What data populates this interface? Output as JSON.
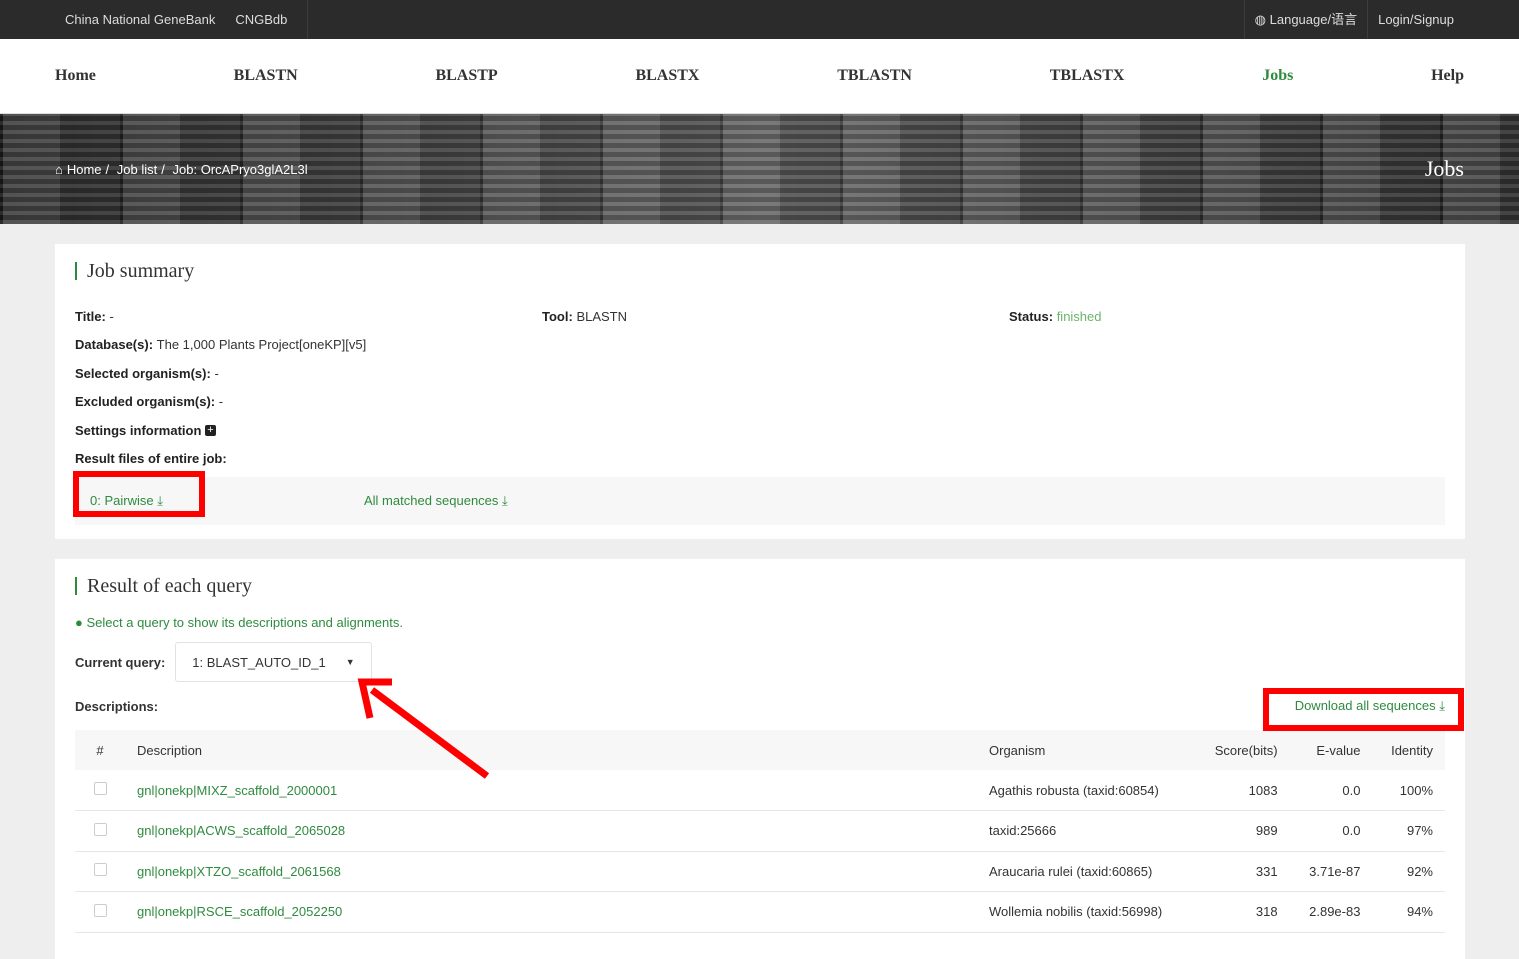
{
  "topbar": {
    "links": [
      "China National GeneBank",
      "CNGBdb"
    ],
    "language": "Language/语言",
    "login": "Login/Signup"
  },
  "nav": {
    "items": [
      "Home",
      "BLASTN",
      "BLASTP",
      "BLASTX",
      "TBLASTN",
      "TBLASTX",
      "Jobs",
      "Help"
    ],
    "active": "Jobs"
  },
  "banner": {
    "breadcrumb": [
      "Home",
      "Job list",
      "Job: OrcAPryo3glA2L3l"
    ],
    "title": "Jobs"
  },
  "summary": {
    "heading": "Job summary",
    "title_label": "Title:",
    "title_value": "-",
    "tool_label": "Tool:",
    "tool_value": "BLASTN",
    "status_label": "Status:",
    "status_value": "finished",
    "db_label": "Database(s):",
    "db_value": "The 1,000 Plants Project[oneKP][v5]",
    "sel_label": "Selected organism(s):",
    "sel_value": "-",
    "exc_label": "Excluded organism(s):",
    "exc_value": "-",
    "settings_label": "Settings information",
    "files_label": "Result files of entire job:",
    "file_pairwise": "0: Pairwise",
    "file_all": "All matched sequences"
  },
  "results": {
    "heading": "Result of each query",
    "hint": "Select a query to show its descriptions and alignments.",
    "query_label": "Current query:",
    "query_value": "1: BLAST_AUTO_ID_1",
    "desc_label": "Descriptions:",
    "download_all": "Download all sequences",
    "columns": [
      "#",
      "Description",
      "Organism",
      "Score(bits)",
      "E-value",
      "Identity"
    ],
    "rows": [
      {
        "desc": "gnl|onekp|MIXZ_scaffold_2000001",
        "org": "Agathis robusta (taxid:60854)",
        "score": "1083",
        "evalue": "0.0",
        "identity": "100%"
      },
      {
        "desc": "gnl|onekp|ACWS_scaffold_2065028",
        "org": "taxid:25666",
        "score": "989",
        "evalue": "0.0",
        "identity": "97%"
      },
      {
        "desc": "gnl|onekp|XTZO_scaffold_2061568",
        "org": "Araucaria rulei (taxid:60865)",
        "score": "331",
        "evalue": "3.71e-87",
        "identity": "92%"
      },
      {
        "desc": "gnl|onekp|RSCE_scaffold_2052250",
        "org": "Wollemia nobilis (taxid:56998)",
        "score": "318",
        "evalue": "2.89e-83",
        "identity": "94%"
      }
    ]
  },
  "colors": {
    "accent": "#2e8b3e",
    "annotation": "#ff0000",
    "topbar": "#2b2b2b"
  }
}
